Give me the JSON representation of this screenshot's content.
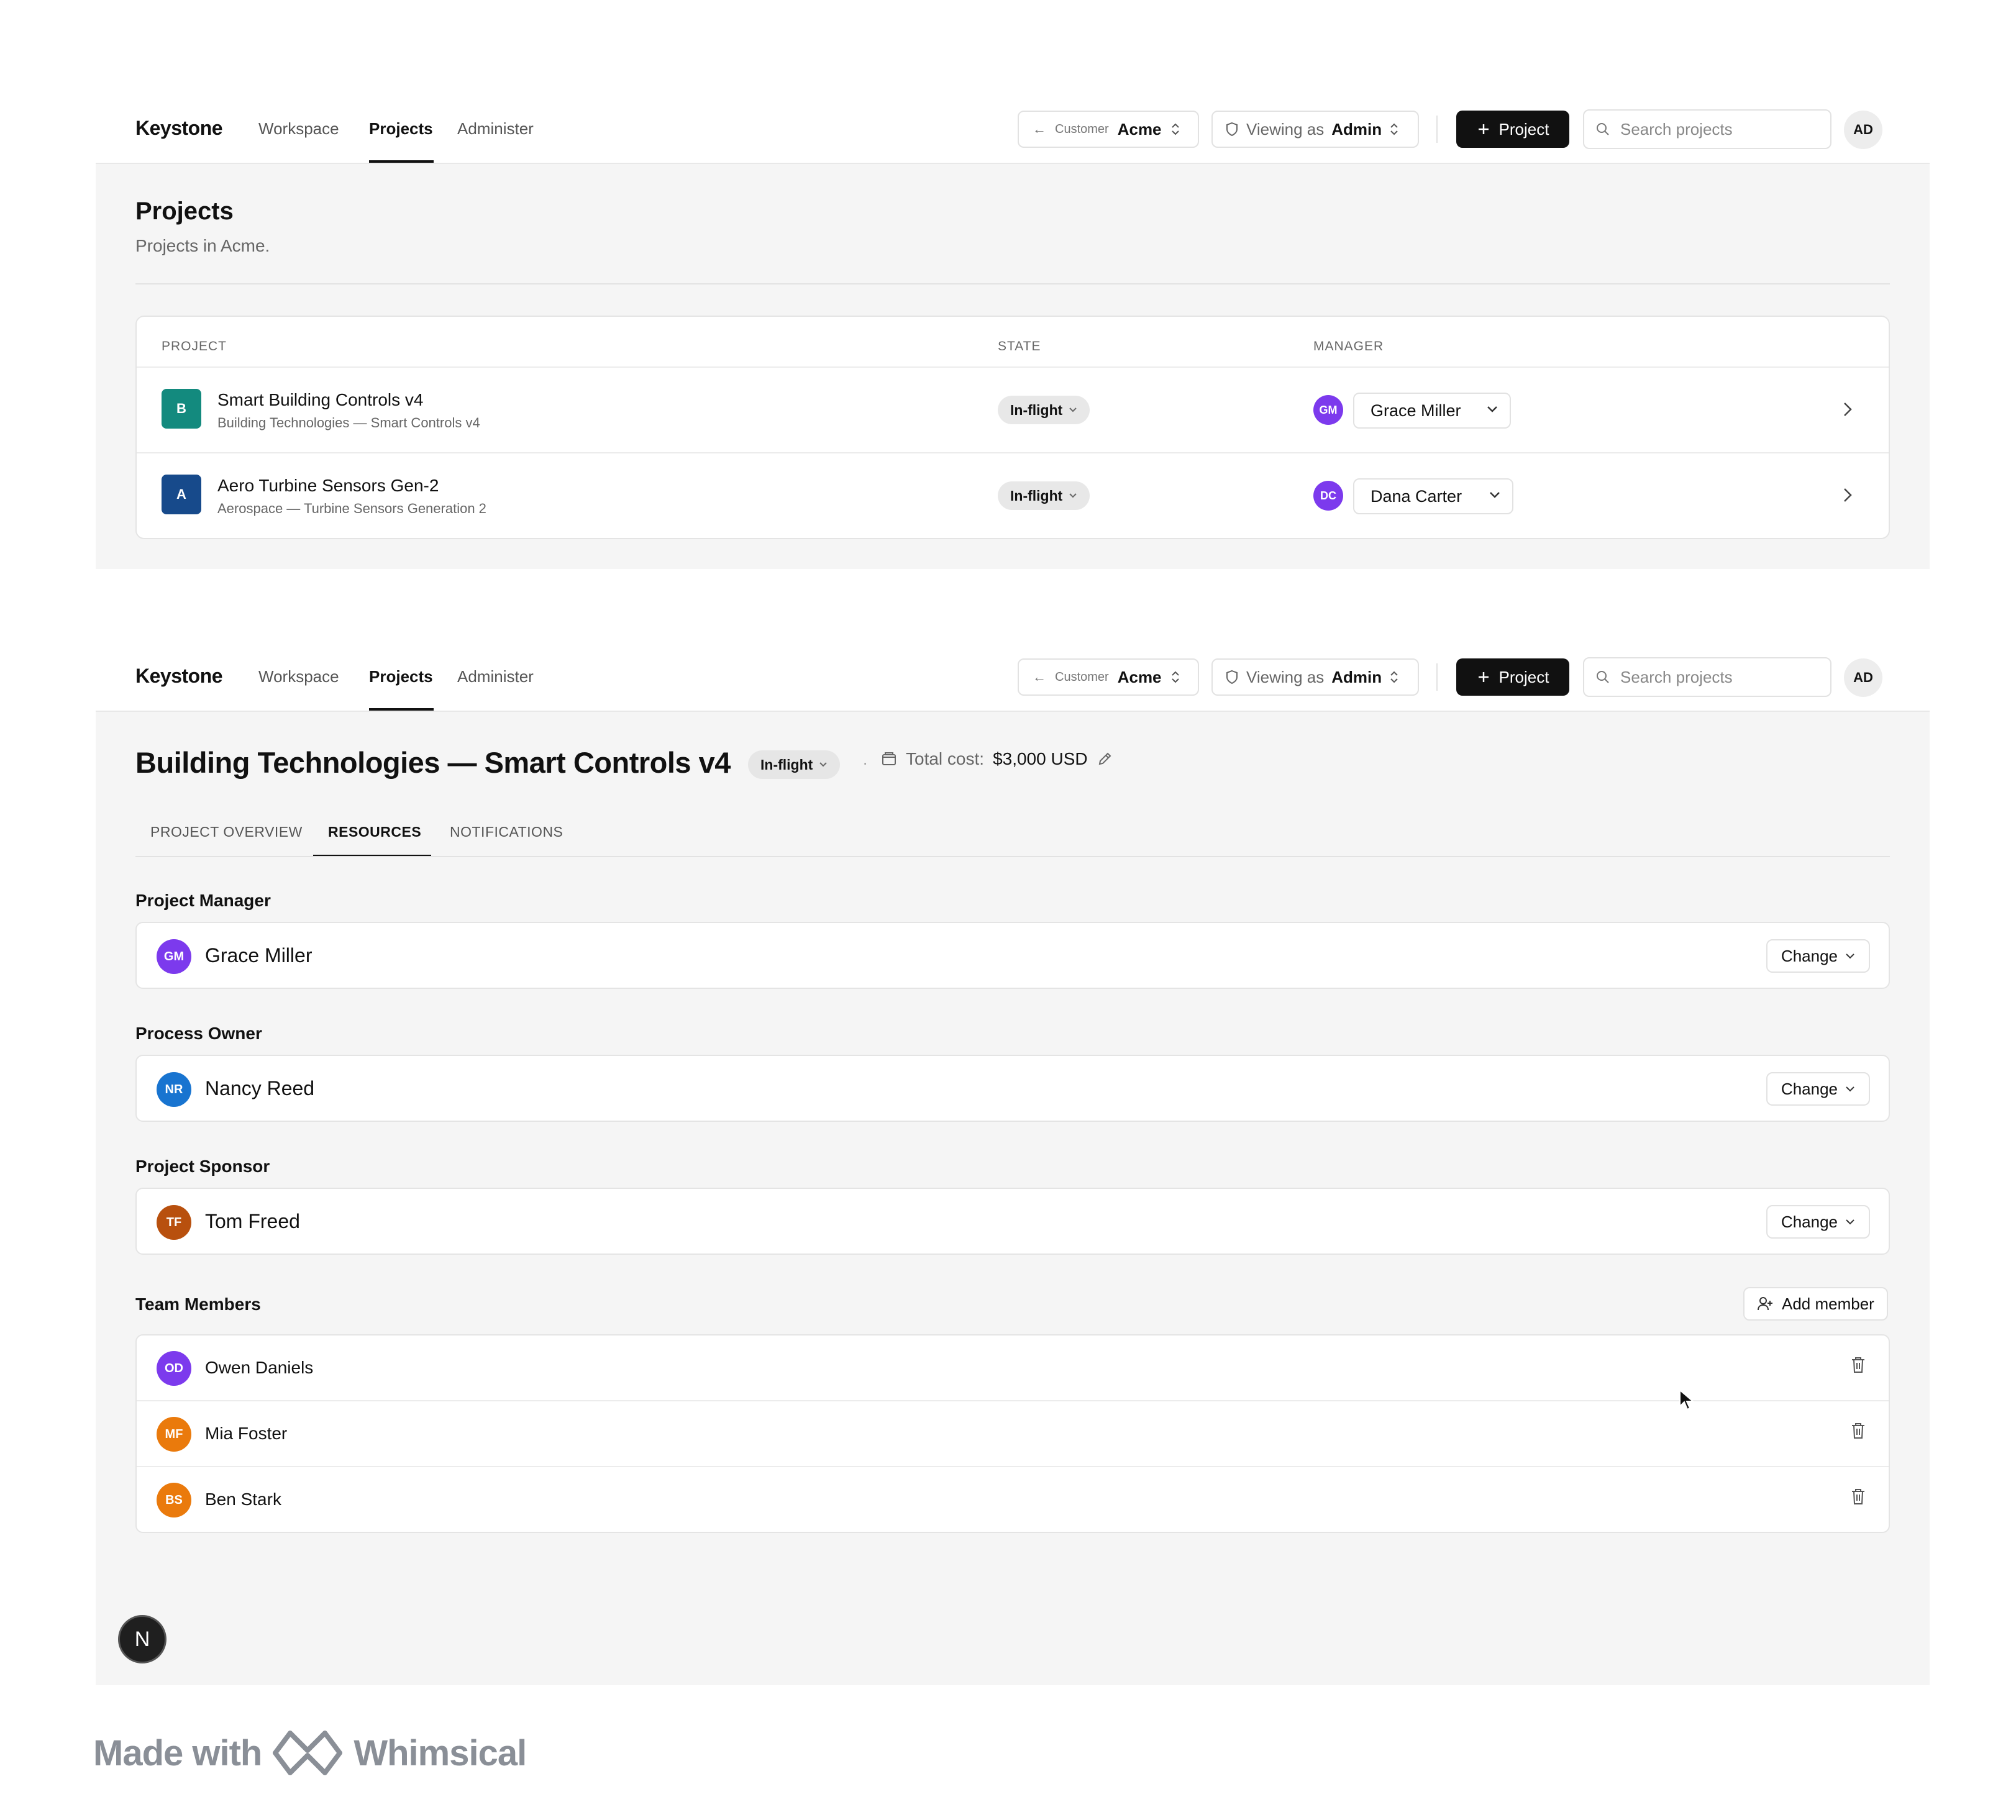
{
  "topbar": {
    "brand": "Keystone",
    "nav": [
      "Workspace",
      "Projects",
      "Administer"
    ],
    "active_nav": "Projects",
    "customer_small": "Customer",
    "customer_value": "Acme",
    "viewing_label": "Viewing as",
    "viewing_value": "Admin",
    "new_project_label": "Project",
    "search_placeholder": "Search projects",
    "avatar": "AD"
  },
  "projects_page": {
    "title": "Projects",
    "subtitle": "Projects in Acme.",
    "columns": [
      "PROJECT",
      "STATE",
      "MANAGER"
    ],
    "rows": [
      {
        "icon_letter": "B",
        "icon_color": "#138a7e",
        "name": "Smart Building Controls v4",
        "sub": "Building Technologies — Smart Controls v4",
        "state": "In-flight",
        "manager_initials": "GM",
        "manager": "Grace Miller"
      },
      {
        "icon_letter": "A",
        "icon_color": "#174a8b",
        "name": "Aero Turbine Sensors Gen-2",
        "sub": "Aerospace — Turbine Sensors Generation 2",
        "state": "In-flight",
        "manager_initials": "DC",
        "manager": "Dana Carter"
      }
    ]
  },
  "detail_page": {
    "title": "Building Technologies — Smart Controls v4",
    "state": "In-flight",
    "cost_label": "Total cost:",
    "cost_value": "$3,000 USD",
    "tabs": [
      "PROJECT OVERVIEW",
      "RESOURCES",
      "NOTIFICATIONS"
    ],
    "active_tab": "RESOURCES",
    "change_label": "Change",
    "roles": [
      {
        "label": "Project Manager",
        "initials": "GM",
        "name": "Grace Miller",
        "color": "#7c3aed"
      },
      {
        "label": "Process Owner",
        "initials": "NR",
        "name": "Nancy Reed",
        "color": "#1874d0"
      },
      {
        "label": "Project Sponsor",
        "initials": "TF",
        "name": "Tom Freed",
        "color": "#b8500e"
      }
    ],
    "team_label": "Team Members",
    "add_member_label": "Add member",
    "team": [
      {
        "initials": "OD",
        "name": "Owen Daniels",
        "color": "#7c3aed"
      },
      {
        "initials": "MF",
        "name": "Mia Foster",
        "color": "#ea7a0c"
      },
      {
        "initials": "BS",
        "name": "Ben Stark",
        "color": "#ea7a0c"
      }
    ]
  },
  "floating_badge": "N",
  "footer": {
    "made_with": "Made with",
    "brand": "Whimsical"
  },
  "colors": {
    "accent_dark": "#111111",
    "manager_gm": "#7c3aed",
    "manager_dc": "#7c3aed"
  },
  "icons": [
    "back-arrow-icon",
    "updown-chevron-icon",
    "shield-icon",
    "plus-icon",
    "search-icon",
    "chevron-down-icon",
    "chevron-right-icon",
    "wallet-icon",
    "pencil-icon",
    "user-plus-icon",
    "trash-icon",
    "cursor-icon",
    "whimsical-logo-icon"
  ]
}
